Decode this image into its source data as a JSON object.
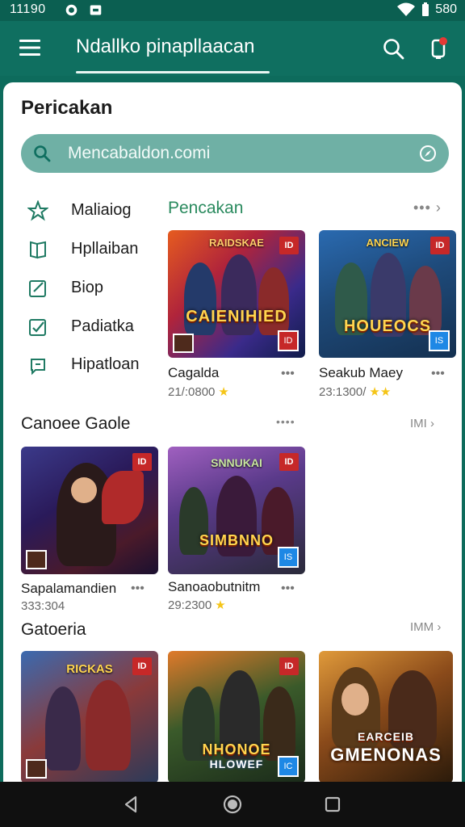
{
  "status": {
    "time": "11190",
    "battery": "580"
  },
  "appbar": {
    "title": "Ndallko pinapllaacan"
  },
  "page": {
    "heading": "Pericakan"
  },
  "search": {
    "placeholder": "Mencabaldon.comi"
  },
  "categories": [
    {
      "label": "Maliaiog",
      "icon": "star-icon"
    },
    {
      "label": "Hpllaiban",
      "icon": "book-icon"
    },
    {
      "label": "Biop",
      "icon": "edit-icon"
    },
    {
      "label": "Padiatka",
      "icon": "check-icon"
    },
    {
      "label": "Hipatloan",
      "icon": "chat-icon"
    }
  ],
  "section1": {
    "title": "Pencakan",
    "more": "••• ›",
    "games": [
      {
        "name": "Cagalda",
        "rating": "21/:0800",
        "stars": "★",
        "title": "CAIENIHIED",
        "subtitle": "RAIDSKAE",
        "badge": "ID",
        "icon2": "ID"
      },
      {
        "name": "Seakub Maey",
        "rating": "23:1300/",
        "stars": "★★",
        "title": "HOUEOCS",
        "subtitle": "ANCIEW",
        "badge": "ID",
        "icon2": "IS"
      }
    ]
  },
  "section2": {
    "title": "Canoee Gaole",
    "dots": "••••",
    "more": "IMI ›",
    "games": [
      {
        "name": "Sapalamandien",
        "rating": "333:304",
        "stars": "",
        "title": "",
        "subtitle": "",
        "badge": "ID",
        "icon2": ""
      },
      {
        "name": "Sanoaobutnitm",
        "rating": "29:2300",
        "stars": "★",
        "title": "SIMBNNO",
        "subtitle": "SNNUKAI",
        "badge": "ID",
        "icon2": "IS"
      }
    ]
  },
  "section3": {
    "title": "Gatoeria",
    "more": "IMM ›",
    "games": [
      {
        "title": "RICKAS",
        "badge": "ID"
      },
      {
        "title": "NHONOE",
        "subtitle": "HLOWEF",
        "badge": "ID",
        "icon2": "IC"
      },
      {
        "title": "GMENONAS",
        "subtitle": "EARCEIB"
      }
    ]
  },
  "colors": {
    "primary": "#0f6f60",
    "accent": "#2a8a5e",
    "star": "#f5c518"
  }
}
